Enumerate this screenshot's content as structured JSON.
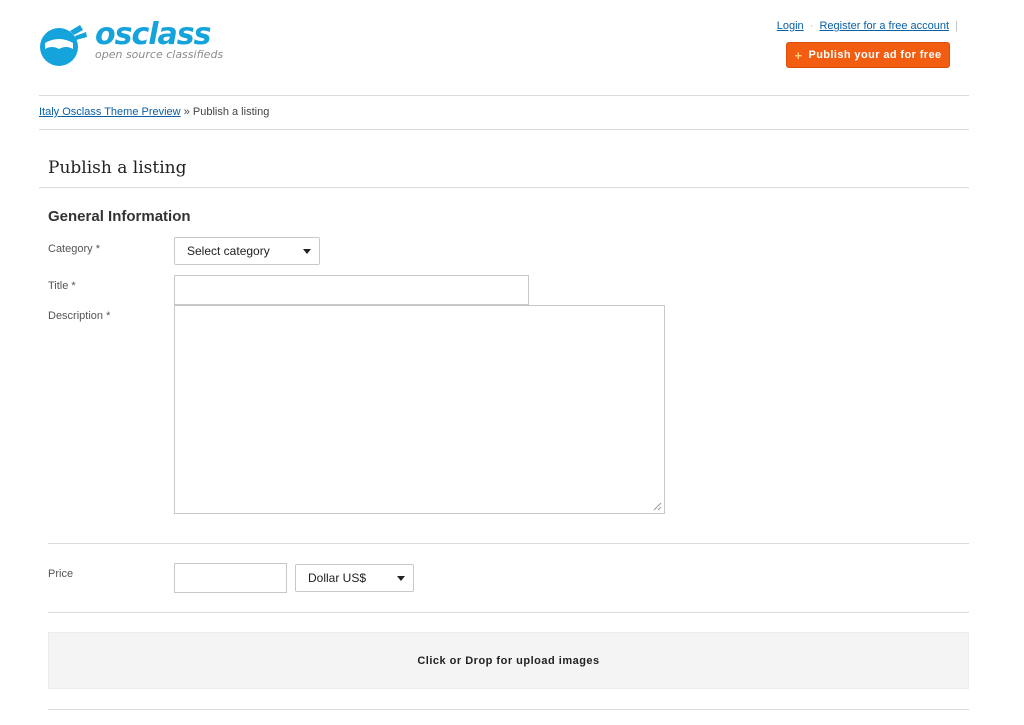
{
  "header": {
    "logo_word": "osclass",
    "logo_tagline": "open source classifieds",
    "login_label": "Login",
    "separator": "·",
    "register_label": "Register for a free account",
    "pipe": "|",
    "publish_button_label": "Publish your ad for free",
    "publish_icon": "+"
  },
  "breadcrumb": {
    "home_label": "Italy Osclass Theme Preview",
    "separator": "»",
    "current": "Publish a listing"
  },
  "page": {
    "title": "Publish a listing",
    "section_title": "General Information"
  },
  "form": {
    "category": {
      "label": "Category *",
      "selected": "Select category"
    },
    "title": {
      "label": "Title *",
      "value": ""
    },
    "description": {
      "label": "Description *",
      "value": ""
    },
    "price": {
      "label": "Price",
      "value": "",
      "currency_selected": "Dollar US$"
    },
    "upload_label": "Click or Drop for upload images"
  },
  "colors": {
    "brand_blue": "#15a3dc",
    "publish_orange": "#f25d12",
    "link_blue": "#0b5fa5"
  }
}
